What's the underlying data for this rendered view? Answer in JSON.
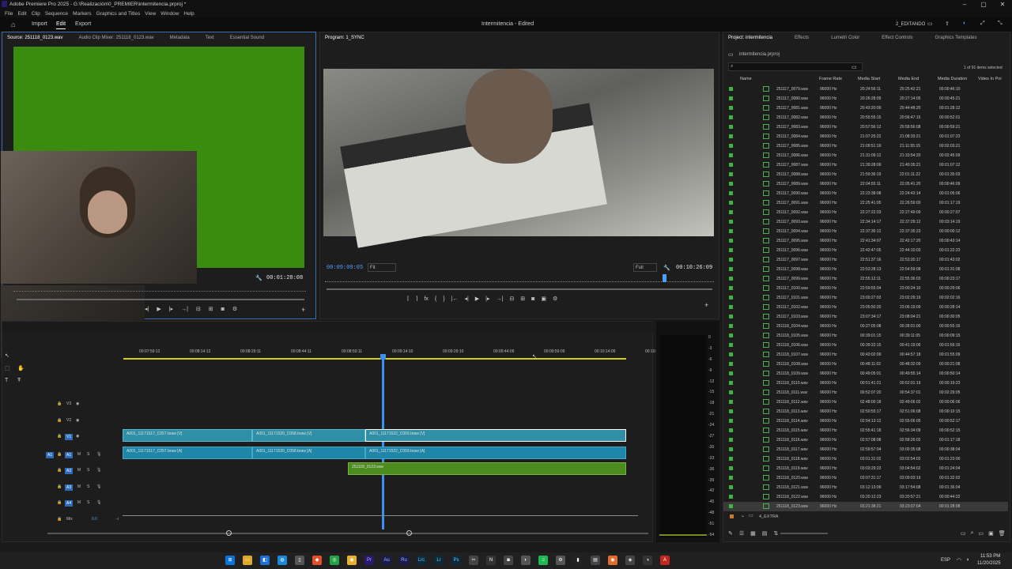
{
  "window": {
    "title": "Adobe Premiere Pro 2025 - G:\\Realización\\0_PREMIER\\intermitencia.prproj *",
    "controls": [
      "–",
      "▢",
      "✕"
    ]
  },
  "menu": [
    "File",
    "Edit",
    "Clip",
    "Sequence",
    "Markers",
    "Graphics and Titles",
    "View",
    "Window",
    "Help"
  ],
  "header": {
    "home_icon": "home-icon",
    "tabs": [
      "Import",
      "Edit",
      "Export"
    ],
    "active_tab": "Edit",
    "project_title": "Intermitencia - Edited",
    "workspace": "2_EDITANDO"
  },
  "source_monitor": {
    "tabs": [
      "Source: 251118_0123.wav",
      "Audio Clip Mixer: 251118_0123.wav",
      "Metadata",
      "Text",
      "Essential Sound"
    ],
    "duration": "00:01:28:08",
    "screen_color": "#3a8c10"
  },
  "program_monitor": {
    "tab": "Program: 1_SYNC",
    "current_time": "00:09:09:05",
    "fit": "Fit",
    "quality": "Full",
    "duration": "00:10:26:09",
    "playhead_fraction": 0.87
  },
  "project_panel": {
    "tabs": [
      "Project: intermitencia",
      "Effects",
      "Lumetri Color",
      "Effect Controls",
      "Graphics Templates"
    ],
    "project_file": "intermitencia.prproj",
    "items_selected": "1 of 91 items selected",
    "columns": [
      "Name",
      "Frame Rate",
      "Media Start",
      "Media End",
      "Media Duration",
      "Video In Poi"
    ],
    "rows": [
      {
        "name": "251117_0079.wav",
        "rate": "96000 Hz",
        "start": "20:24:56:11",
        "end": "20:25:42:21",
        "dur": "00:00:46:10"
      },
      {
        "name": "251117_0080.wav",
        "rate": "96000 Hz",
        "start": "20:26:28:09",
        "end": "20:27:14:05",
        "dur": "00:00:45:21"
      },
      {
        "name": "251117_0081.wav",
        "rate": "96000 Hz",
        "start": "20:43:20:09",
        "end": "20:44:48:20",
        "dur": "00:01:28:12"
      },
      {
        "name": "251117_0082.wav",
        "rate": "96000 Hz",
        "start": "20:55:55:15",
        "end": "20:56:47:15",
        "dur": "00:00:52:01"
      },
      {
        "name": "251117_0083.wav",
        "rate": "96000 Hz",
        "start": "20:57:56:12",
        "end": "20:58:56:08",
        "dur": "00:00:59:21"
      },
      {
        "name": "251117_0084.wav",
        "rate": "96000 Hz",
        "start": "21:07:25:22",
        "end": "21:08:33:21",
        "dur": "00:01:07:23"
      },
      {
        "name": "251117_0085.wav",
        "rate": "96000 Hz",
        "start": "21:09:51:19",
        "end": "21:11:55:15",
        "dur": "00:02:03:21"
      },
      {
        "name": "251117_0086.wav",
        "rate": "96000 Hz",
        "start": "21:31:09:12",
        "end": "21:33:54:20",
        "dur": "00:02:45:09"
      },
      {
        "name": "251117_0087.wav",
        "rate": "96000 Hz",
        "start": "21:39:28:09",
        "end": "21:40:35:21",
        "dur": "00:01:07:12"
      },
      {
        "name": "251117_0088.wav",
        "rate": "96000 Hz",
        "start": "21:59:36:19",
        "end": "22:01:11:22",
        "dur": "00:01:35:03"
      },
      {
        "name": "251117_0089.wav",
        "rate": "96000 Hz",
        "start": "22:04:55:11",
        "end": "22:05:41:20",
        "dur": "00:00:46:09"
      },
      {
        "name": "251117_0090.wav",
        "rate": "96000 Hz",
        "start": "22:23:38:08",
        "end": "22:24:43:14",
        "dur": "00:01:05:06"
      },
      {
        "name": "251117_0091.wav",
        "rate": "96000 Hz",
        "start": "22:25:41:05",
        "end": "22:26:59:00",
        "dur": "00:01:17:19"
      },
      {
        "name": "251117_0092.wav",
        "rate": "96000 Hz",
        "start": "22:27:22:03",
        "end": "22:27:49:09",
        "dur": "00:00:27:07"
      },
      {
        "name": "251117_0093.wav",
        "rate": "96000 Hz",
        "start": "22:34:14:17",
        "end": "22:37:29:12",
        "dur": "00:03:14:19"
      },
      {
        "name": "251117_0094.wav",
        "rate": "96000 Hz",
        "start": "22:37:35:12",
        "end": "22:37:35:23",
        "dur": "00:00:00:12"
      },
      {
        "name": "251117_0095.wav",
        "rate": "96000 Hz",
        "start": "22:41:34:07",
        "end": "22:42:17:20",
        "dur": "00:00:43:14"
      },
      {
        "name": "251117_0096.wav",
        "rate": "96000 Hz",
        "start": "22:42:47:05",
        "end": "22:44:10:03",
        "dur": "00:01:22:23"
      },
      {
        "name": "251117_0097.wav",
        "rate": "96000 Hz",
        "start": "22:51:37:16",
        "end": "22:53:20:17",
        "dur": "00:01:43:02"
      },
      {
        "name": "251117_0098.wav",
        "rate": "96000 Hz",
        "start": "22:53:28:13",
        "end": "22:54:59:08",
        "dur": "00:01:31:08"
      },
      {
        "name": "251117_0099.wav",
        "rate": "96000 Hz",
        "start": "22:55:12:11",
        "end": "22:55:36:03",
        "dur": "00:00:23:17"
      },
      {
        "name": "251117_0100.wav",
        "rate": "96000 Hz",
        "start": "22:59:55:04",
        "end": "23:00:24:10",
        "dur": "00:00:29:06"
      },
      {
        "name": "251117_0101.wav",
        "rate": "96000 Hz",
        "start": "23:00:27:03",
        "end": "23:02:29:19",
        "dur": "00:02:02:16"
      },
      {
        "name": "251117_0102.wav",
        "rate": "96000 Hz",
        "start": "23:05:50:20",
        "end": "23:06:19:09",
        "dur": "00:00:28:14"
      },
      {
        "name": "251117_0103.wav",
        "rate": "96000 Hz",
        "start": "23:07:34:17",
        "end": "23:08:04:21",
        "dur": "00:00:30:05"
      },
      {
        "name": "251118_0104.wav",
        "rate": "96000 Hz",
        "start": "00:27:05:08",
        "end": "00:28:01:00",
        "dur": "00:00:55:16"
      },
      {
        "name": "251118_0105.wav",
        "rate": "96000 Hz",
        "start": "00:39:01:15",
        "end": "00:39:11:05",
        "dur": "00:00:09:15"
      },
      {
        "name": "251118_0106.wav",
        "rate": "96000 Hz",
        "start": "00:39:22:15",
        "end": "00:41:19:06",
        "dur": "00:01:56:16"
      },
      {
        "name": "251118_0107.wav",
        "rate": "96000 Hz",
        "start": "00:43:02:09",
        "end": "00:44:57:18",
        "dur": "00:01:55:09"
      },
      {
        "name": "251118_0108.wav",
        "rate": "96000 Hz",
        "start": "00:48:11:02",
        "end": "00:48:32:09",
        "dur": "00:00:21:08"
      },
      {
        "name": "251118_0109.wav",
        "rate": "96000 Hz",
        "start": "00:49:05:01",
        "end": "00:49:55:14",
        "dur": "00:00:50:14"
      },
      {
        "name": "251118_0110.wav",
        "rate": "96000 Hz",
        "start": "00:51:41:21",
        "end": "00:52:01:19",
        "dur": "00:00:19:23"
      },
      {
        "name": "251118_0111.wav",
        "rate": "96000 Hz",
        "start": "00:52:07:20",
        "end": "00:54:37:01",
        "dur": "00:02:29:05"
      },
      {
        "name": "251118_0112.wav",
        "rate": "96000 Hz",
        "start": "02:48:00:18",
        "end": "02:49:06:02",
        "dur": "00:00:06:06"
      },
      {
        "name": "251118_0113.wav",
        "rate": "96000 Hz",
        "start": "02:50:55:17",
        "end": "02:51:06:08",
        "dur": "00:00:10:15"
      },
      {
        "name": "251118_0114.wav",
        "rate": "96000 Hz",
        "start": "02:54:13:12",
        "end": "02:55:06:05",
        "dur": "00:00:52:17"
      },
      {
        "name": "251118_0115.wav",
        "rate": "96000 Hz",
        "start": "02:55:41:18",
        "end": "02:56:34:09",
        "dur": "00:00:52:15"
      },
      {
        "name": "251118_0116.wav",
        "rate": "96000 Hz",
        "start": "02:57:08:08",
        "end": "02:58:26:02",
        "dur": "00:01:17:18"
      },
      {
        "name": "251118_0117.wav",
        "rate": "96000 Hz",
        "start": "02:59:57:04",
        "end": "03:00:35:08",
        "dur": "00:00:38:04"
      },
      {
        "name": "251118_0118.wav",
        "rate": "96000 Hz",
        "start": "03:01:31:02",
        "end": "03:02:54:02",
        "dur": "00:01:23:00"
      },
      {
        "name": "251118_0119.wav",
        "rate": "96000 Hz",
        "start": "03:03:29:23",
        "end": "03:04:54:02",
        "dur": "00:01:24:04"
      },
      {
        "name": "251118_0120.wav",
        "rate": "96000 Hz",
        "start": "03:07:31:17",
        "end": "03:09:03:19",
        "dur": "00:01:32:02"
      },
      {
        "name": "251118_0121.wav",
        "rate": "96000 Hz",
        "start": "03:12:13:09",
        "end": "03:17:54:08",
        "dur": "00:01:36:04"
      },
      {
        "name": "251118_0122.wav",
        "rate": "96000 Hz",
        "start": "03:20:12:23",
        "end": "03:20:57:21",
        "dur": "00:00:44:22"
      },
      {
        "name": "251118_0123.wav",
        "rate": "96000 Hz",
        "start": "03:21:38:21",
        "end": "03:23:07:04",
        "dur": "00:01:28:08"
      }
    ],
    "bin": "4_EXTRA"
  },
  "timeline": {
    "ruler": [
      "00:07:59:12",
      "00:08:14:12",
      "00:08:29:11",
      "00:08:44:11",
      "00:08:59:11",
      "00:09:14:10",
      "00:09:29:10",
      "00:09:44:09",
      "00:09:59:09",
      "00:10:14:09",
      "00:10:29"
    ],
    "tracks": [
      "V3",
      "V2",
      "V1",
      "A1",
      "A2",
      "A3",
      "A4"
    ],
    "mix_label": "Mix",
    "mix_value": "0.0",
    "clips_v1": [
      "A001_11171517_C057.braw [V]",
      "A001_11171520_C058.braw [V]",
      "A001_11171522_C059.braw [V]"
    ],
    "clips_a1": [
      "A001_11171517_C057.braw [A]",
      "A001_11171520_C058.braw [A]",
      "A001_11171522_C059.braw [A]"
    ],
    "clip_a2": "251118_0123.wav",
    "meter_scale": [
      "0",
      "-3",
      "-6",
      "-9",
      "-12",
      "-15",
      "-18",
      "-21",
      "-24",
      "-27",
      "-30",
      "-33",
      "-36",
      "-39",
      "-42",
      "-45",
      "-48",
      "-51",
      "-54"
    ]
  },
  "taskbar": {
    "language": "ESP",
    "time": "11:53 PM",
    "date": "11/20/2025"
  }
}
